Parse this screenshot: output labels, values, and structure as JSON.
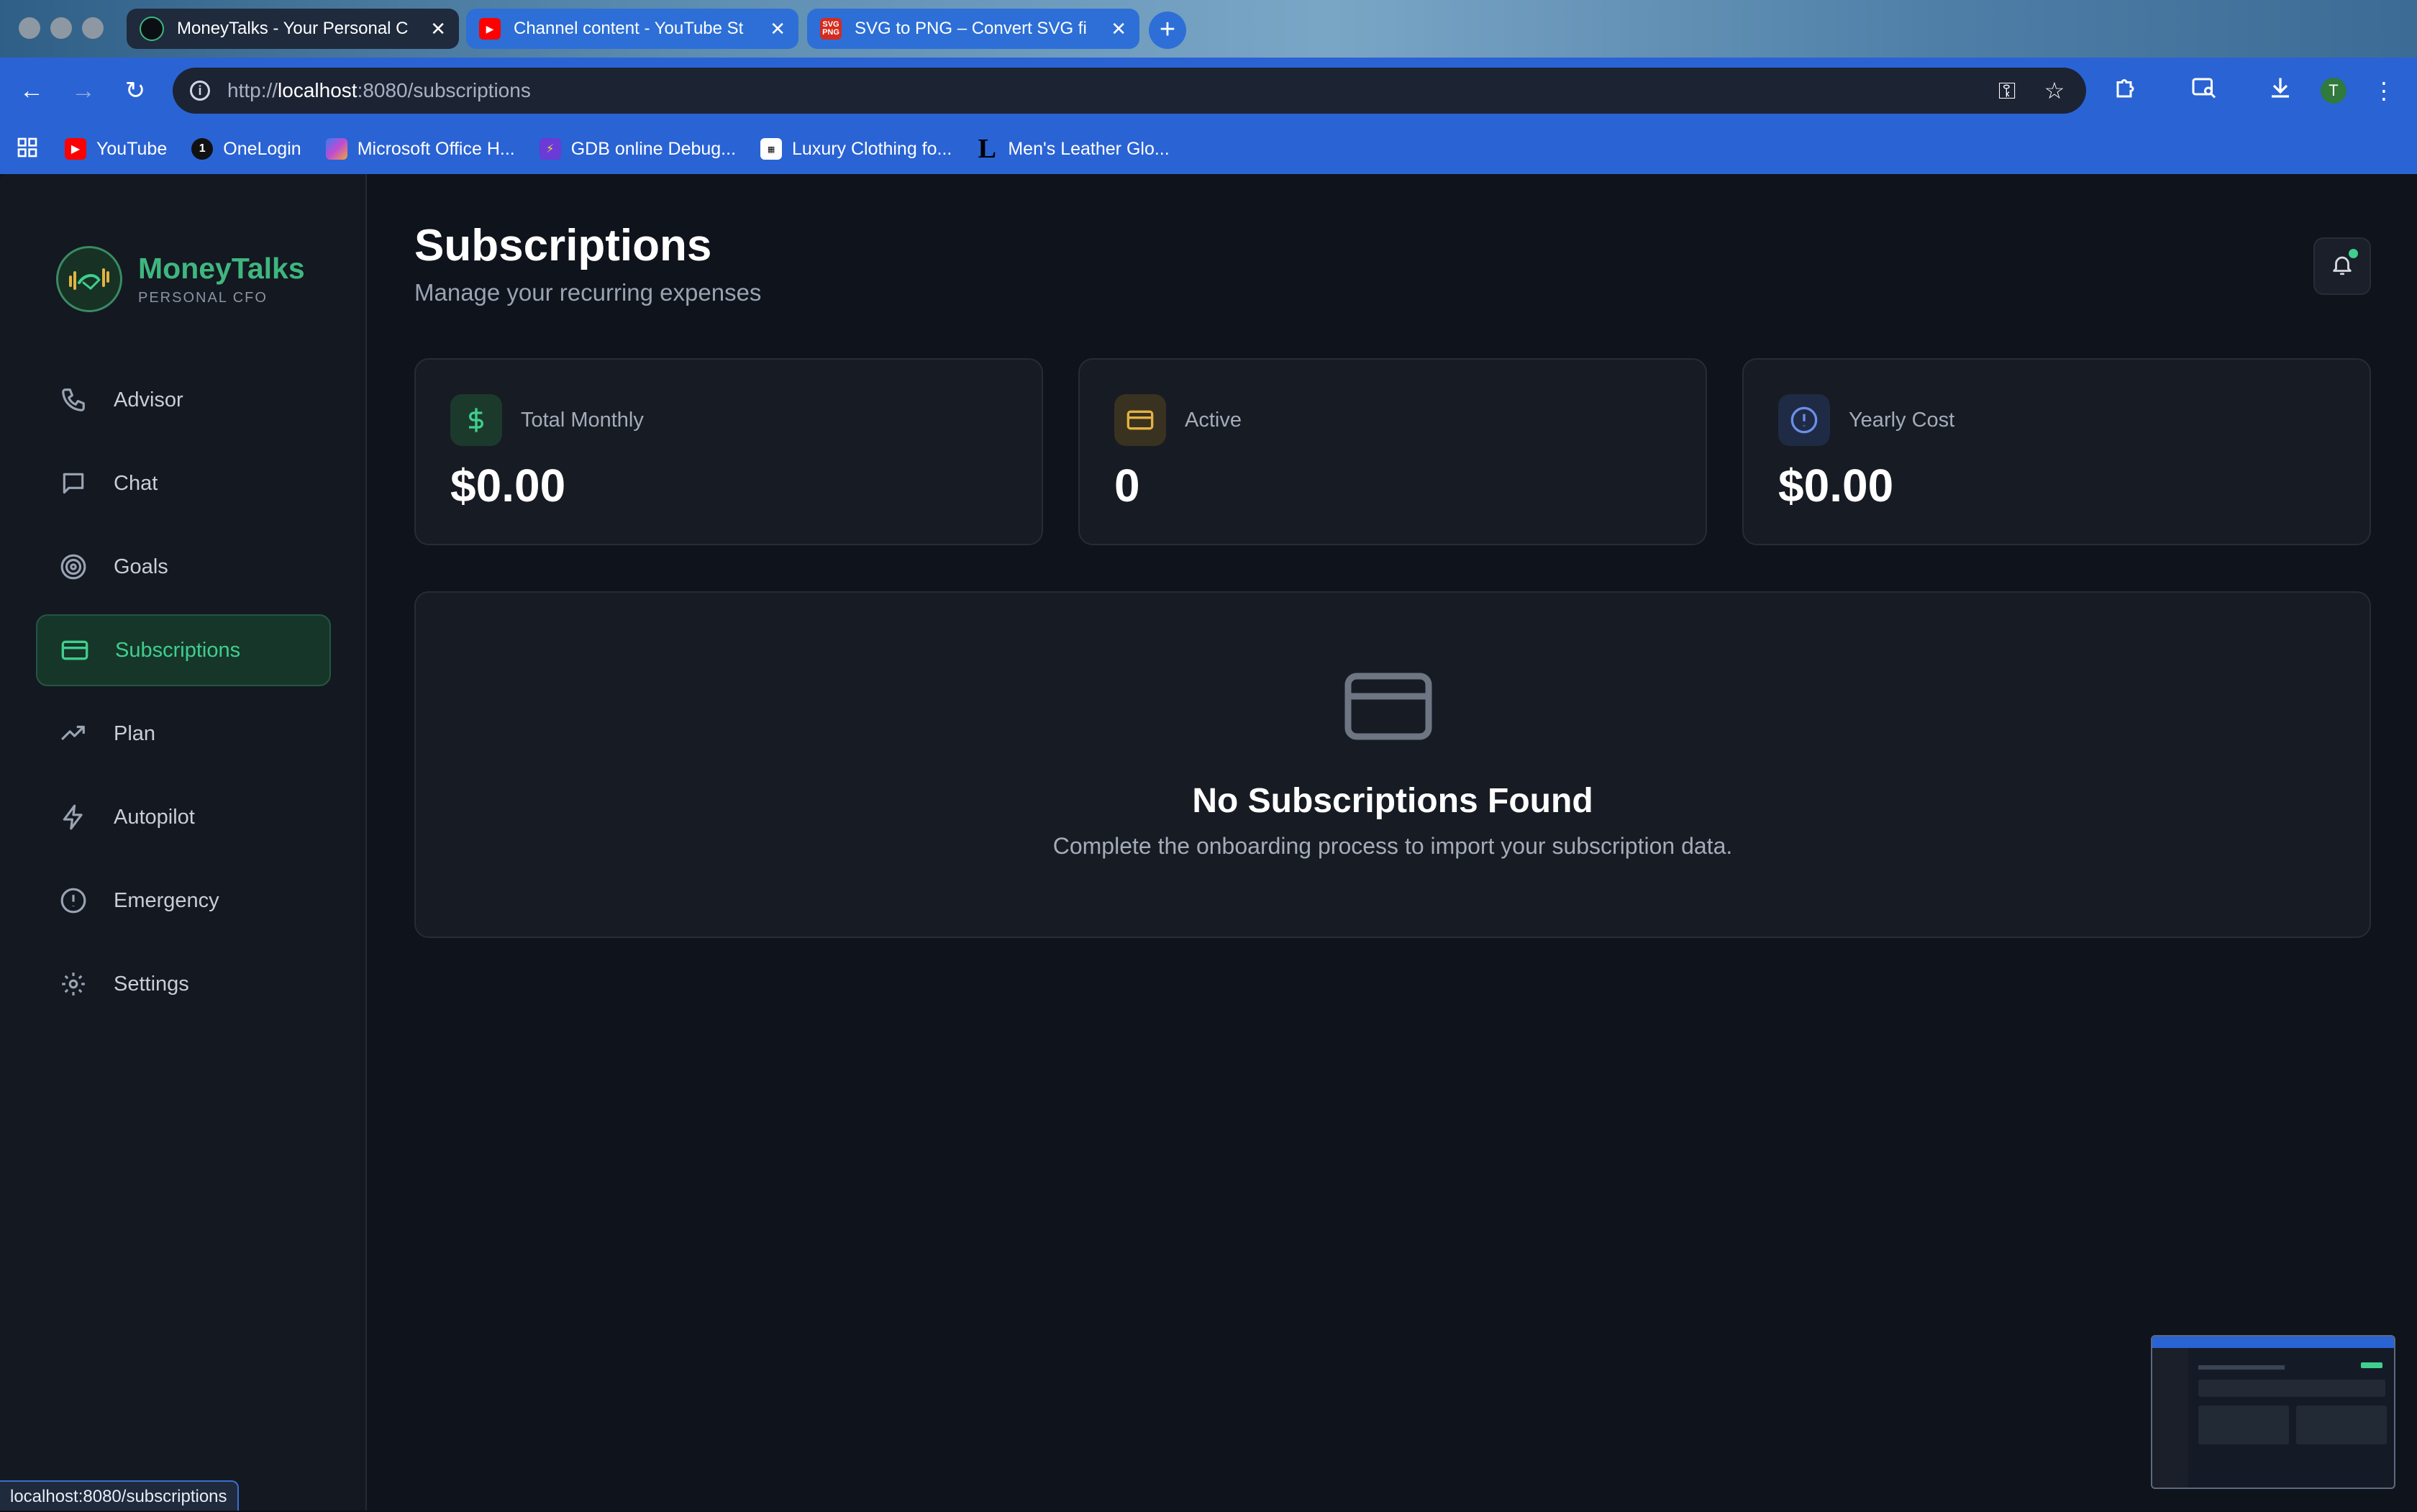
{
  "browser": {
    "tabs": [
      {
        "title": "MoneyTalks - Your Personal C",
        "active": true
      },
      {
        "title": "Channel content - YouTube St",
        "active": false
      },
      {
        "title": "SVG to PNG – Convert SVG fi",
        "active": false
      }
    ],
    "url_scheme": "http://",
    "url_host": "localhost",
    "url_rest": ":8080/subscriptions",
    "profile_initial": "T",
    "bookmarks": [
      {
        "label": "YouTube",
        "icon": "youtube-icon",
        "color": "#ff0000"
      },
      {
        "label": "OneLogin",
        "icon": "onelogin-icon",
        "color": "#111111"
      },
      {
        "label": "Microsoft Office H...",
        "icon": "office-icon",
        "color": "#c04bd3"
      },
      {
        "label": "GDB online Debug...",
        "icon": "gdb-icon",
        "color": "#6a3bd6"
      },
      {
        "label": "Luxury Clothing fo...",
        "icon": "clothing-icon",
        "color": "#ffffff"
      },
      {
        "label": "Men's Leather Glo...",
        "icon": "l-logo-icon",
        "color": "#000000"
      }
    ],
    "status_url": "localhost:8080/subscriptions"
  },
  "brand": {
    "name": "MoneyTalks",
    "tagline": "PERSONAL CFO",
    "accent": "#3fb67e"
  },
  "sidebar": {
    "items": [
      {
        "label": "Advisor",
        "icon": "phone-icon",
        "active": false
      },
      {
        "label": "Chat",
        "icon": "chat-bubble-icon",
        "active": false
      },
      {
        "label": "Goals",
        "icon": "target-icon",
        "active": false
      },
      {
        "label": "Subscriptions",
        "icon": "credit-card-icon",
        "active": true
      },
      {
        "label": "Plan",
        "icon": "trending-up-icon",
        "active": false
      },
      {
        "label": "Autopilot",
        "icon": "lightning-icon",
        "active": false
      },
      {
        "label": "Emergency",
        "icon": "alert-circle-icon",
        "active": false
      },
      {
        "label": "Settings",
        "icon": "gear-icon",
        "active": false
      }
    ]
  },
  "header": {
    "title": "Subscriptions",
    "subtitle": "Manage your recurring expenses"
  },
  "stats": [
    {
      "label": "Total Monthly",
      "value": "$0.00",
      "icon": "dollar-icon",
      "color": "#3fcf8e"
    },
    {
      "label": "Active",
      "value": "0",
      "icon": "credit-card-icon",
      "color": "#e3b341"
    },
    {
      "label": "Yearly Cost",
      "value": "$0.00",
      "icon": "alert-circle-icon",
      "color": "#6b8ee8"
    }
  ],
  "empty_state": {
    "icon": "credit-card-icon",
    "title": "No Subscriptions Found",
    "message": "Complete the onboarding process to import your subscription data."
  }
}
